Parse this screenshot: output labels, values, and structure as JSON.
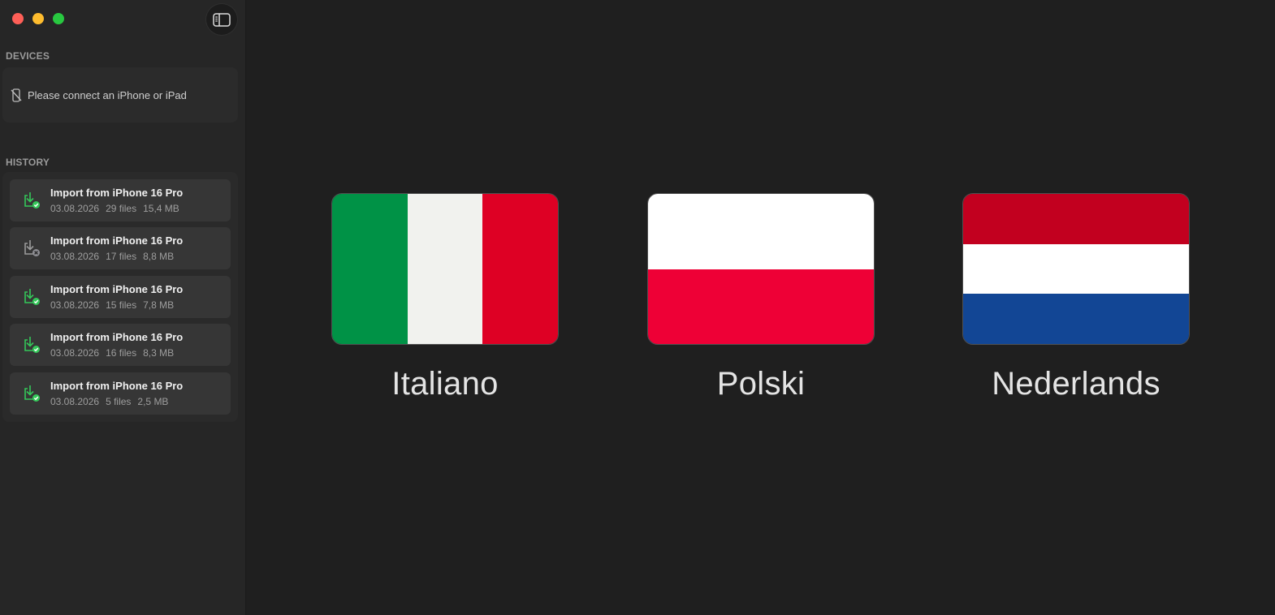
{
  "window": {
    "controls": [
      "close",
      "minimize",
      "zoom"
    ],
    "sidebar_toggle_icon": "sidebar-toggle-icon"
  },
  "sidebar": {
    "devices_label": "DEVICES",
    "devices_empty_text": "Please connect an iPhone or iPad",
    "devices_empty_icon": "iphone-slash-icon",
    "history_label": "HISTORY",
    "history": [
      {
        "title": "Import from iPhone 16 Pro",
        "date": "03.08.2026",
        "files": "29 files",
        "size": "15,4 MB",
        "status": "success"
      },
      {
        "title": "Import from iPhone 16 Pro",
        "date": "03.08.2026",
        "files": "17 files",
        "size": "8,8 MB",
        "status": "failed"
      },
      {
        "title": "Import from iPhone 16 Pro",
        "date": "03.08.2026",
        "files": "15 files",
        "size": "7,8 MB",
        "status": "success"
      },
      {
        "title": "Import from iPhone 16 Pro",
        "date": "03.08.2026",
        "files": "16 files",
        "size": "8,3 MB",
        "status": "success"
      },
      {
        "title": "Import from iPhone 16 Pro",
        "date": "03.08.2026",
        "files": "5 files",
        "size": "2,5 MB",
        "status": "success"
      }
    ]
  },
  "languages": [
    {
      "label": "Italiano",
      "orientation": "vertical",
      "colors": [
        "#009246",
        "#f1f2ee",
        "#de0024"
      ]
    },
    {
      "label": "Polski",
      "orientation": "horizontal",
      "colors": [
        "#ffffff",
        "#ee0036"
      ]
    },
    {
      "label": "Nederlands",
      "orientation": "horizontal",
      "colors": [
        "#c2001f",
        "#ffffff",
        "#124695"
      ]
    }
  ],
  "colors": {
    "success": "#34c759",
    "failed": "#8e8e93"
  }
}
